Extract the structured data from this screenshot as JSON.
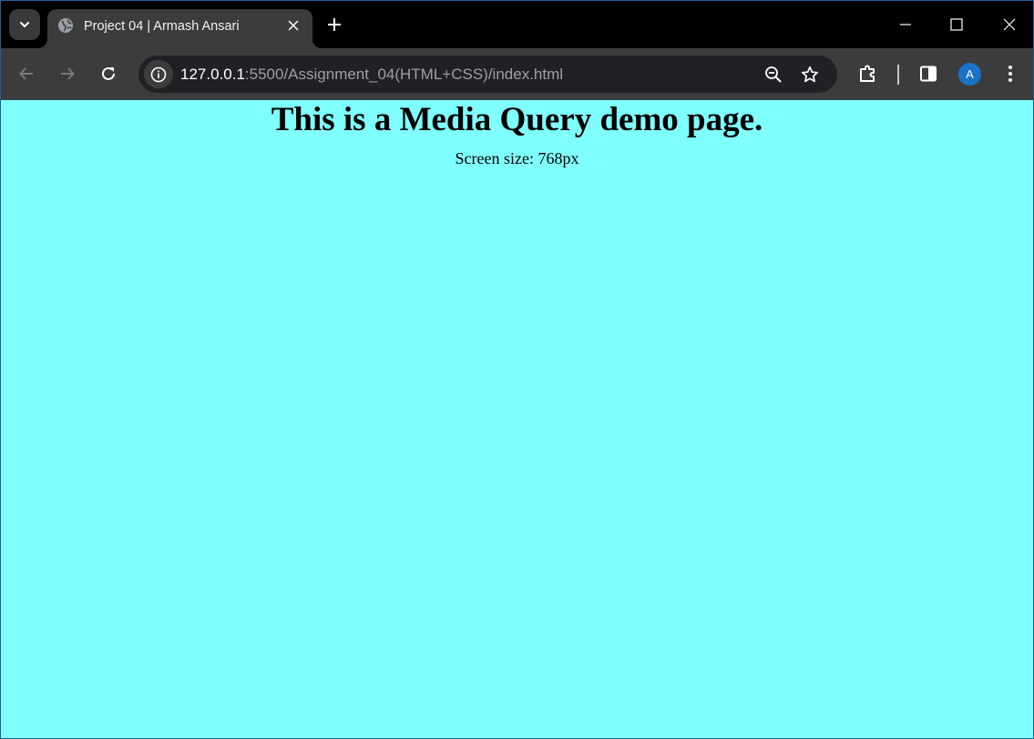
{
  "browser": {
    "tab_title": "Project 04 | Armash Ansari",
    "url_host": "127.0.0.1",
    "url_rest": ":5500/Assignment_04(HTML+CSS)/index.html",
    "profile_initial": "A",
    "accent_color": "#1a73c8",
    "icons": {
      "tab_search": "chevron-down-icon",
      "favicon": "globe-icon",
      "tab_close": "close-icon",
      "new_tab": "plus-icon",
      "minimize": "minimize-icon",
      "maximize": "maximize-icon",
      "close_window": "close-icon",
      "back": "arrow-left-icon",
      "forward": "arrow-right-icon",
      "reload": "reload-icon",
      "site_info": "info-icon",
      "zoom": "zoom-out-icon",
      "bookmark": "star-icon",
      "extensions": "puzzle-icon",
      "side_panel": "side-panel-icon",
      "menu": "kebab-menu-icon"
    }
  },
  "page": {
    "background_color": "#7ffffe",
    "heading": "This is a Media Query demo page.",
    "screen_size_text": "Screen size: 768px"
  }
}
